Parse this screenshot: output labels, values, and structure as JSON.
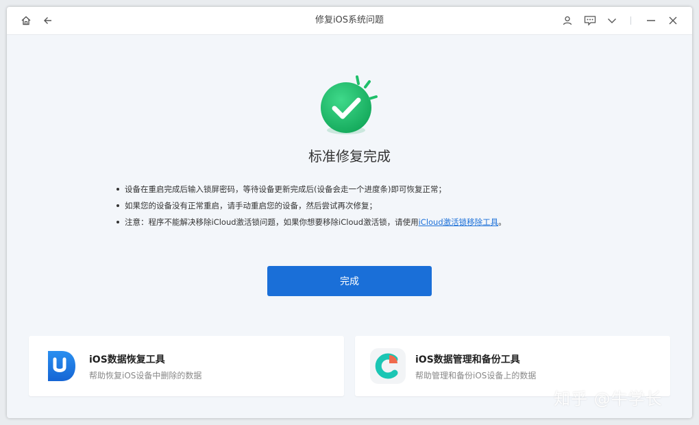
{
  "window": {
    "title": "修复iOS系统问题",
    "icons": [
      "home-icon",
      "back-icon",
      "user-icon",
      "feedback-icon",
      "chevron-down-icon",
      "minimize-icon",
      "close-icon"
    ]
  },
  "status": {
    "heading": "标准修复完成",
    "notes": [
      "设备在重启完成后输入锁屏密码，等待设备更新完成后(设备会走一个进度条)即可恢复正常；",
      "如果您的设备没有正常重启，请手动重启您的设备，然后尝试再次修复；"
    ],
    "note3_prefix": "注意：程序不能解决移除iCloud激活锁问题，如果你想要移除iCloud激活锁，请使用",
    "note3_link": "iCloud激活锁移除工具",
    "note3_suffix": "。"
  },
  "actions": {
    "done_label": "完成"
  },
  "cards": [
    {
      "title": "iOS数据恢复工具",
      "desc": "帮助恢复iOS设备中删除的数据",
      "icon": "ultdata-logo-icon"
    },
    {
      "title": "iOS数据管理和备份工具",
      "desc": "帮助管理和备份iOS设备上的数据",
      "icon": "icarefone-logo-icon"
    }
  ],
  "watermark": "知乎 @牛学长",
  "colors": {
    "primary": "#1a6fd8",
    "success": "#1fbf6a",
    "background": "#f3f6fa"
  }
}
